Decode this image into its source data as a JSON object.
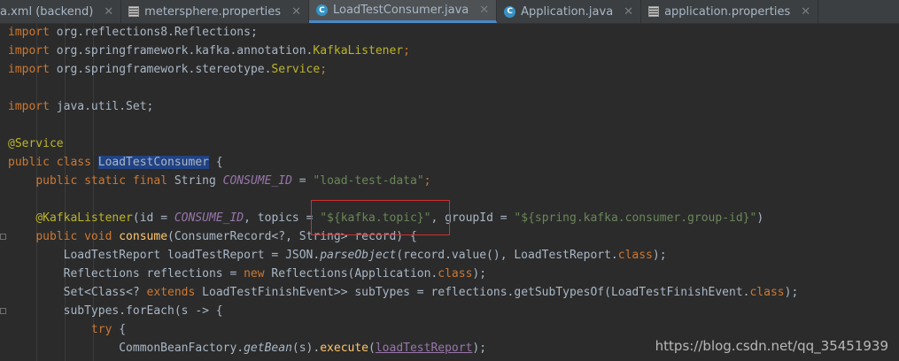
{
  "tabs": [
    {
      "label": "a.xml (backend)",
      "icon": "xml-file-icon",
      "active": false
    },
    {
      "label": "metersphere.properties",
      "icon": "properties-file-icon",
      "active": false
    },
    {
      "label": "LoadTestConsumer.java",
      "icon": "java-class-icon",
      "active": true
    },
    {
      "label": "Application.java",
      "icon": "java-class-icon",
      "active": false
    },
    {
      "label": "application.properties",
      "icon": "properties-file-icon",
      "active": false
    }
  ],
  "code": {
    "l1": [
      "import",
      " org.reflections8.Reflections;"
    ],
    "l2": [
      "import",
      " org.springframework.kafka.annotation.",
      "KafkaListener",
      ";"
    ],
    "l3": [
      "import",
      " org.springframework.stereotype.",
      "Service",
      ";"
    ],
    "l5": [
      "import",
      " java.util.Set;"
    ],
    "l7": [
      "@Service"
    ],
    "l8": [
      "public class ",
      "LoadTestConsumer",
      " {"
    ],
    "l9": [
      "    ",
      "public static final ",
      "String ",
      "CONSUME_ID",
      " = ",
      "\"load-test-data\"",
      ";"
    ],
    "l11": [
      "    ",
      "@KafkaListener",
      "(id = ",
      "CONSUME_ID",
      ", topics = ",
      "\"${kafka.topic}\"",
      ", groupId = ",
      "\"${spring.kafka.consumer.group-id}\"",
      ")"
    ],
    "l12": [
      "    ",
      "public void ",
      "consume",
      "(ConsumerRecord<?, String> record) {"
    ],
    "l13": [
      "        LoadTestReport loadTestReport = JSON.",
      "parseObject",
      "(record.value(), LoadTestReport.",
      "class",
      ");"
    ],
    "l14": [
      "        Reflections reflections = ",
      "new ",
      "Reflections(Application.",
      "class",
      ");"
    ],
    "l15": [
      "        Set<Class<? ",
      "extends ",
      "LoadTestFinishEvent>> subTypes = reflections.getSubTypesOf(LoadTestFinishEvent.",
      "class",
      ");"
    ],
    "l16": [
      "        subTypes.forEach(s -> {"
    ],
    "l17": [
      "            ",
      "try ",
      "{"
    ],
    "l18": [
      "                CommonBeanFactory.",
      "getBean",
      "(s).",
      "execute",
      "(",
      "loadTestReport",
      ");"
    ]
  },
  "watermark": "https://blog.csdn.net/qq_35451939",
  "colors": {
    "keyword": "#cc7832",
    "string": "#6a8759",
    "annotation": "#bbb529",
    "constant": "#9876aa",
    "method": "#ffc66d",
    "highlight_box": "#d03030"
  }
}
